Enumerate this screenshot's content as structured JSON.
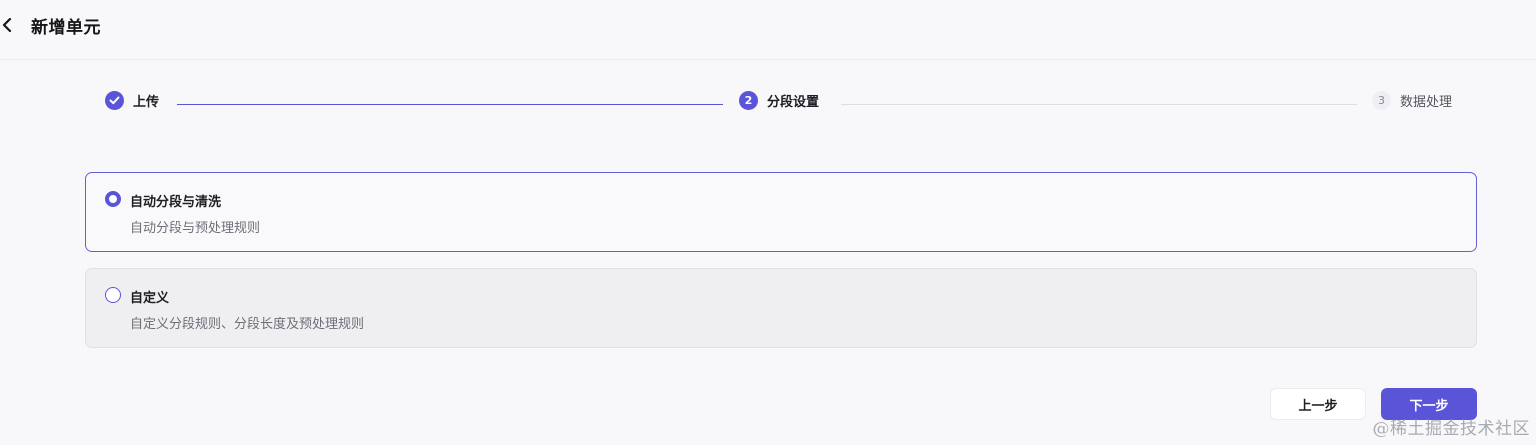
{
  "header": {
    "title": "新增单元",
    "back_icon": "chevron-left-icon"
  },
  "steps": [
    {
      "label": "上传",
      "number": "1",
      "state": "done",
      "icon": "check-circle-icon"
    },
    {
      "label": "分段设置",
      "number": "2",
      "state": "active"
    },
    {
      "label": "数据处理",
      "number": "3",
      "state": "pending"
    }
  ],
  "options": [
    {
      "title": "自动分段与清洗",
      "description": "自动分段与预处理规则",
      "selected": true
    },
    {
      "title": "自定义",
      "description": "自定义分段规则、分段长度及预处理规则",
      "selected": false
    }
  ],
  "buttons": {
    "prev_label": "上一步",
    "next_label": "下一步"
  },
  "watermark": "@稀土掘金技术社区",
  "colors": {
    "accent": "#5a55d8",
    "background": "#f8f8fa",
    "selected_border": "#6460d6"
  }
}
